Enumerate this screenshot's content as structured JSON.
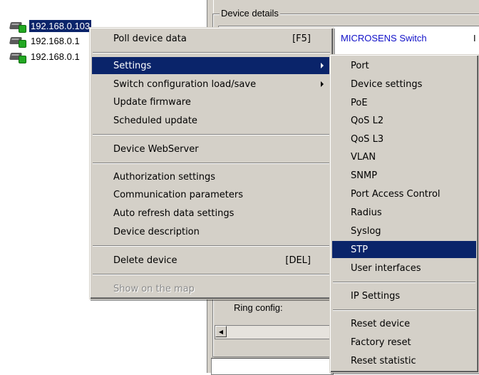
{
  "tree": {
    "items": [
      {
        "label": "192.168.0.103",
        "selected": true
      },
      {
        "label": "192.168.0.1",
        "selected": false
      },
      {
        "label": "192.168.0.1",
        "selected": false
      }
    ]
  },
  "pane": {
    "group_title": "Device details",
    "device_name": "MICROSENS Switch",
    "cut_char": "I",
    "ring_label": "Ring config:"
  },
  "context_menu": {
    "poll": {
      "label": "Poll device data",
      "shortcut": "[F5]"
    },
    "settings": {
      "label": "Settings",
      "highlighted": true
    },
    "switch_config": {
      "label": "Switch configuration load/save"
    },
    "update_firmware": {
      "label": "Update firmware"
    },
    "scheduled_update": {
      "label": "Scheduled update"
    },
    "webserver": {
      "label": "Device WebServer"
    },
    "auth_settings": {
      "label": "Authorization settings"
    },
    "comm_params": {
      "label": "Communication parameters"
    },
    "auto_refresh": {
      "label": "Auto refresh data settings"
    },
    "device_description": {
      "label": "Device description"
    },
    "delete_device": {
      "label": "Delete device",
      "shortcut": "[DEL]"
    },
    "show_on_map": {
      "label": "Show on the map",
      "disabled": true
    }
  },
  "settings_submenu": {
    "port": "Port",
    "device_settings": "Device settings",
    "poe": "PoE",
    "qos_l2": "QoS L2",
    "qos_l3": "QoS L3",
    "vlan": "VLAN",
    "snmp": "SNMP",
    "port_access_control": "Port Access Control",
    "radius": "Radius",
    "syslog": "Syslog",
    "stp": "STP",
    "user_interfaces": "User interfaces",
    "ip_settings": "IP Settings",
    "reset_device": "Reset device",
    "factory_reset": "Factory reset",
    "reset_statistic": "Reset statistic",
    "highlighted_item": "STP"
  },
  "colors": {
    "highlight": "#0a246a",
    "menu_face": "#d4d0c8",
    "device_name": "#1010c8",
    "status_led": "#22a822"
  }
}
